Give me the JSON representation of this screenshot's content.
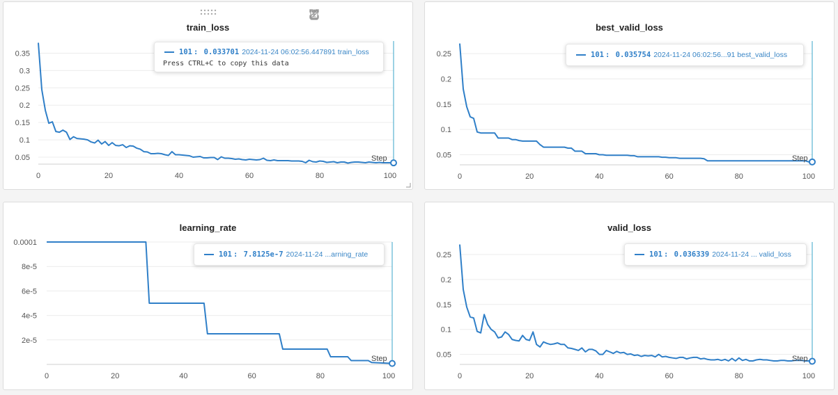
{
  "colors": {
    "line": "#2f7fc8",
    "grid": "#ececec",
    "axis": "#555555",
    "marker": "#3aa6c9"
  },
  "toolbar": {
    "icons": [
      "clipboard-icon",
      "share-icon",
      "edit-icon",
      "fullscreen-icon",
      "more-icon"
    ]
  },
  "panels": [
    {
      "title": "train_loss",
      "tooltip": {
        "step": "101",
        "value": "0.033701",
        "rest": "2024-11-24 06:02:56.447891 train_loss",
        "hint": "Press CTRL+C to copy this data"
      }
    },
    {
      "title": "best_valid_loss",
      "tooltip": {
        "step": "101",
        "value": "0.035754",
        "rest": "2024-11-24 06:02:56...91 best_valid_loss"
      }
    },
    {
      "title": "learning_rate",
      "tooltip": {
        "step": "101",
        "value": "7.8125e-7",
        "rest": "2024-11-24 ...arning_rate"
      }
    },
    {
      "title": "valid_loss",
      "tooltip": {
        "step": "101",
        "value": "0.036339",
        "rest": "2024-11-24 ... valid_loss"
      }
    }
  ],
  "chart_data": [
    {
      "type": "line",
      "title": "train_loss",
      "xlabel": "Step",
      "xlim": [
        0,
        101
      ],
      "ylim": [
        0.03,
        0.385
      ],
      "xticks": [
        0,
        20,
        40,
        60,
        80,
        100
      ],
      "yticks": [
        0.05,
        0.1,
        0.15,
        0.2,
        0.25,
        0.3,
        0.35
      ],
      "ytick_labels": [
        "0.05",
        "0.1",
        "0.15",
        "0.2",
        "0.25",
        "0.3",
        "0.35"
      ],
      "x": [
        0,
        1,
        2,
        3,
        4,
        5,
        6,
        7,
        8,
        9,
        10,
        11,
        12,
        13,
        14,
        15,
        16,
        17,
        18,
        19,
        20,
        21,
        22,
        23,
        24,
        25,
        26,
        27,
        28,
        29,
        30,
        31,
        32,
        33,
        34,
        35,
        36,
        37,
        38,
        39,
        40,
        41,
        42,
        43,
        44,
        45,
        46,
        47,
        48,
        49,
        50,
        51,
        52,
        53,
        54,
        55,
        56,
        57,
        58,
        59,
        60,
        61,
        62,
        63,
        64,
        65,
        66,
        67,
        68,
        69,
        70,
        71,
        72,
        73,
        74,
        75,
        76,
        77,
        78,
        79,
        80,
        81,
        82,
        83,
        84,
        85,
        86,
        87,
        88,
        89,
        90,
        91,
        92,
        93,
        94,
        95,
        96,
        97,
        98,
        99,
        100,
        101
      ],
      "y": [
        0.38,
        0.245,
        0.185,
        0.148,
        0.152,
        0.124,
        0.122,
        0.128,
        0.122,
        0.101,
        0.109,
        0.104,
        0.103,
        0.102,
        0.1,
        0.094,
        0.091,
        0.099,
        0.088,
        0.095,
        0.084,
        0.092,
        0.084,
        0.083,
        0.086,
        0.078,
        0.083,
        0.082,
        0.076,
        0.073,
        0.066,
        0.065,
        0.06,
        0.06,
        0.061,
        0.06,
        0.057,
        0.055,
        0.066,
        0.057,
        0.057,
        0.056,
        0.055,
        0.054,
        0.05,
        0.051,
        0.052,
        0.048,
        0.048,
        0.049,
        0.049,
        0.043,
        0.051,
        0.047,
        0.047,
        0.046,
        0.044,
        0.045,
        0.043,
        0.042,
        0.044,
        0.043,
        0.042,
        0.043,
        0.047,
        0.041,
        0.04,
        0.042,
        0.04,
        0.04,
        0.04,
        0.04,
        0.039,
        0.039,
        0.039,
        0.038,
        0.034,
        0.041,
        0.037,
        0.036,
        0.039,
        0.038,
        0.035,
        0.036,
        0.037,
        0.034,
        0.036,
        0.036,
        0.033,
        0.035,
        0.036,
        0.036,
        0.035,
        0.034,
        0.036,
        0.035,
        0.034,
        0.035,
        0.034,
        0.034,
        0.034,
        0.0337
      ]
    },
    {
      "type": "line",
      "title": "best_valid_loss",
      "xlabel": "Step",
      "xlim": [
        0,
        101
      ],
      "ylim": [
        0.03,
        0.275
      ],
      "xticks": [
        0,
        20,
        40,
        60,
        80,
        100
      ],
      "yticks": [
        0.05,
        0.1,
        0.15,
        0.2,
        0.25
      ],
      "ytick_labels": [
        "0.05",
        "0.1",
        "0.15",
        "0.2",
        "0.25"
      ],
      "x": [
        0,
        1,
        2,
        3,
        4,
        5,
        6,
        7,
        8,
        9,
        10,
        11,
        12,
        13,
        14,
        15,
        16,
        17,
        18,
        19,
        20,
        21,
        22,
        23,
        24,
        25,
        26,
        27,
        28,
        29,
        30,
        31,
        32,
        33,
        34,
        35,
        36,
        37,
        38,
        39,
        40,
        41,
        42,
        43,
        44,
        45,
        46,
        47,
        48,
        49,
        50,
        51,
        52,
        53,
        54,
        55,
        56,
        57,
        58,
        59,
        60,
        61,
        62,
        63,
        64,
        65,
        66,
        67,
        68,
        69,
        70,
        71,
        72,
        73,
        74,
        75,
        76,
        77,
        78,
        79,
        80,
        81,
        82,
        83,
        84,
        85,
        86,
        87,
        88,
        89,
        90,
        91,
        92,
        93,
        94,
        95,
        96,
        97,
        98,
        99,
        100,
        101
      ],
      "y": [
        0.27,
        0.18,
        0.145,
        0.125,
        0.122,
        0.095,
        0.093,
        0.093,
        0.093,
        0.093,
        0.093,
        0.083,
        0.083,
        0.083,
        0.083,
        0.08,
        0.08,
        0.078,
        0.077,
        0.077,
        0.077,
        0.077,
        0.077,
        0.07,
        0.065,
        0.065,
        0.065,
        0.065,
        0.065,
        0.065,
        0.065,
        0.063,
        0.063,
        0.057,
        0.057,
        0.057,
        0.052,
        0.052,
        0.052,
        0.052,
        0.05,
        0.05,
        0.049,
        0.049,
        0.049,
        0.049,
        0.049,
        0.049,
        0.049,
        0.048,
        0.048,
        0.046,
        0.046,
        0.046,
        0.046,
        0.046,
        0.046,
        0.046,
        0.045,
        0.045,
        0.044,
        0.044,
        0.044,
        0.043,
        0.043,
        0.043,
        0.043,
        0.043,
        0.043,
        0.043,
        0.042,
        0.038,
        0.038,
        0.038,
        0.038,
        0.038,
        0.038,
        0.038,
        0.038,
        0.038,
        0.038,
        0.038,
        0.038,
        0.038,
        0.038,
        0.038,
        0.038,
        0.038,
        0.038,
        0.038,
        0.038,
        0.038,
        0.038,
        0.038,
        0.038,
        0.038,
        0.038,
        0.038,
        0.038,
        0.038,
        0.0358,
        0.035754
      ]
    },
    {
      "type": "line",
      "title": "learning_rate",
      "xlabel": "Step",
      "xlim": [
        0,
        101
      ],
      "ylim": [
        0,
        0.0001
      ],
      "xticks": [
        0,
        20,
        40,
        60,
        80,
        100
      ],
      "yticks": [
        2e-05,
        4e-05,
        6e-05,
        8e-05,
        0.0001
      ],
      "ytick_labels": [
        "2e-5",
        "4e-5",
        "6e-5",
        "8e-5",
        "0.0001"
      ],
      "x": [
        0,
        29,
        30,
        46,
        47,
        68,
        69,
        82,
        83,
        88,
        89,
        94,
        95,
        101
      ],
      "y": [
        0.0001,
        0.0001,
        5e-05,
        5e-05,
        2.5e-05,
        2.5e-05,
        1.25e-05,
        1.25e-05,
        6.25e-06,
        6.25e-06,
        3.125e-06,
        3.125e-06,
        1.5625e-06,
        7.8125e-07
      ]
    },
    {
      "type": "line",
      "title": "valid_loss",
      "xlabel": "Step",
      "xlim": [
        0,
        101
      ],
      "ylim": [
        0.03,
        0.275
      ],
      "xticks": [
        0,
        20,
        40,
        60,
        80,
        100
      ],
      "yticks": [
        0.05,
        0.1,
        0.15,
        0.2,
        0.25
      ],
      "ytick_labels": [
        "0.05",
        "0.1",
        "0.15",
        "0.2",
        "0.25"
      ],
      "x": [
        0,
        1,
        2,
        3,
        4,
        5,
        6,
        7,
        8,
        9,
        10,
        11,
        12,
        13,
        14,
        15,
        16,
        17,
        18,
        19,
        20,
        21,
        22,
        23,
        24,
        25,
        26,
        27,
        28,
        29,
        30,
        31,
        32,
        33,
        34,
        35,
        36,
        37,
        38,
        39,
        40,
        41,
        42,
        43,
        44,
        45,
        46,
        47,
        48,
        49,
        50,
        51,
        52,
        53,
        54,
        55,
        56,
        57,
        58,
        59,
        60,
        61,
        62,
        63,
        64,
        65,
        66,
        67,
        68,
        69,
        70,
        71,
        72,
        73,
        74,
        75,
        76,
        77,
        78,
        79,
        80,
        81,
        82,
        83,
        84,
        85,
        86,
        87,
        88,
        89,
        90,
        91,
        92,
        93,
        94,
        95,
        96,
        97,
        98,
        99,
        100,
        101
      ],
      "y": [
        0.27,
        0.18,
        0.145,
        0.125,
        0.123,
        0.096,
        0.093,
        0.13,
        0.11,
        0.1,
        0.095,
        0.083,
        0.085,
        0.095,
        0.09,
        0.08,
        0.078,
        0.077,
        0.088,
        0.08,
        0.078,
        0.095,
        0.07,
        0.065,
        0.075,
        0.072,
        0.07,
        0.071,
        0.073,
        0.07,
        0.07,
        0.063,
        0.062,
        0.06,
        0.058,
        0.063,
        0.055,
        0.06,
        0.06,
        0.057,
        0.05,
        0.05,
        0.058,
        0.055,
        0.052,
        0.056,
        0.053,
        0.054,
        0.05,
        0.051,
        0.048,
        0.049,
        0.046,
        0.048,
        0.047,
        0.048,
        0.045,
        0.05,
        0.045,
        0.046,
        0.044,
        0.043,
        0.042,
        0.044,
        0.044,
        0.041,
        0.043,
        0.044,
        0.044,
        0.041,
        0.042,
        0.04,
        0.039,
        0.039,
        0.04,
        0.038,
        0.04,
        0.037,
        0.042,
        0.037,
        0.043,
        0.038,
        0.04,
        0.037,
        0.037,
        0.039,
        0.04,
        0.039,
        0.039,
        0.038,
        0.037,
        0.037,
        0.038,
        0.038,
        0.037,
        0.037,
        0.038,
        0.038,
        0.038,
        0.037,
        0.037,
        0.036339
      ]
    }
  ]
}
